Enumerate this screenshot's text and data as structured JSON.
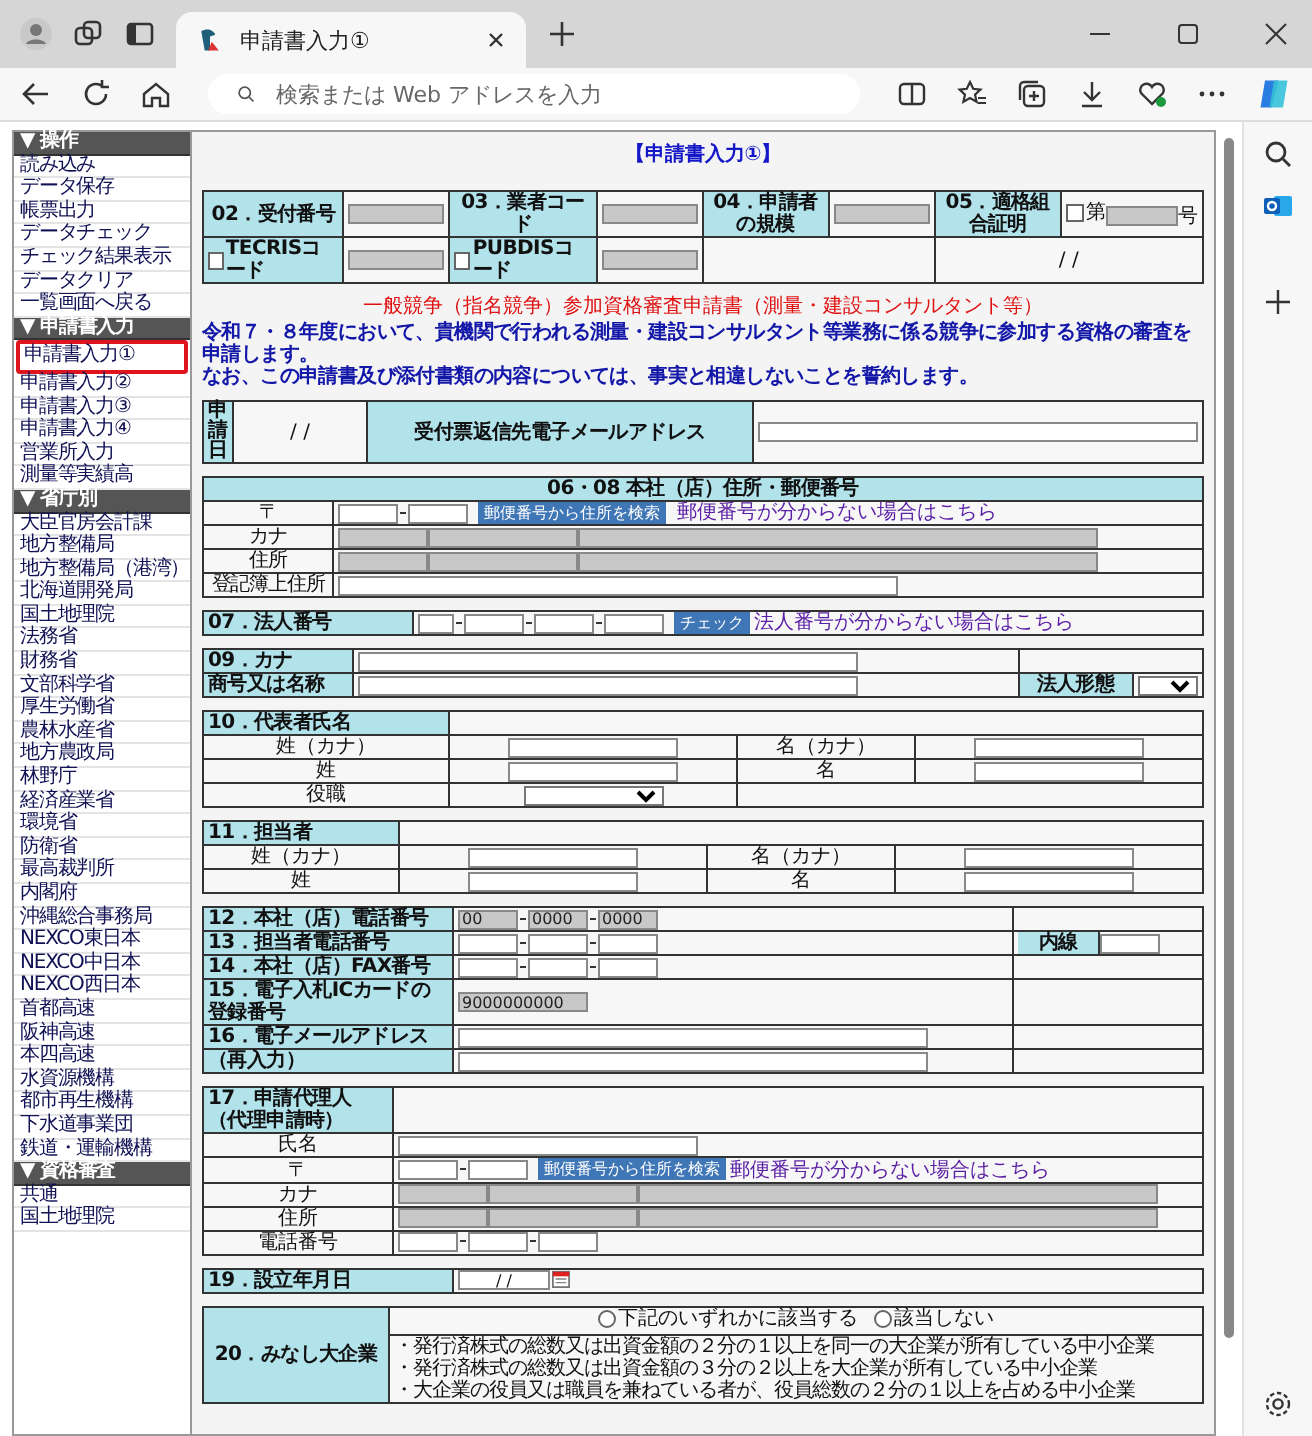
{
  "browser": {
    "tab_title": "申請書入力①",
    "address_placeholder": "検索または Web アドレスを入力"
  },
  "sidebar": [
    {
      "heading": "▼ 操作",
      "items": [
        {
          "label": "読み込み",
          "selected": false
        },
        {
          "label": "データ保存",
          "selected": false
        },
        {
          "label": "帳票出力",
          "selected": false
        },
        {
          "label": "データチェック",
          "selected": false
        },
        {
          "label": "チェック結果表示",
          "selected": false
        },
        {
          "label": "データクリア",
          "selected": false
        },
        {
          "label": "一覧画面へ戻る",
          "selected": false
        }
      ]
    },
    {
      "heading": "▼ 申請書入力",
      "items": [
        {
          "label": "申請書入力①",
          "selected": true
        },
        {
          "label": "申請書入力②",
          "selected": false
        },
        {
          "label": "申請書入力③",
          "selected": false
        },
        {
          "label": "申請書入力④",
          "selected": false
        },
        {
          "label": "営業所入力",
          "selected": false
        },
        {
          "label": "測量等実績高",
          "selected": false
        }
      ]
    },
    {
      "heading": "▼ 省庁別",
      "items": [
        {
          "label": "大臣官房会計課",
          "selected": false
        },
        {
          "label": "地方整備局",
          "selected": false
        },
        {
          "label": "地方整備局（港湾）",
          "selected": false
        },
        {
          "label": "北海道開発局",
          "selected": false
        },
        {
          "label": "国土地理院",
          "selected": false
        },
        {
          "label": "法務省",
          "selected": false
        },
        {
          "label": "財務省",
          "selected": false
        },
        {
          "label": "文部科学省",
          "selected": false
        },
        {
          "label": "厚生労働省",
          "selected": false
        },
        {
          "label": "農林水産省",
          "selected": false
        },
        {
          "label": "地方農政局",
          "selected": false
        },
        {
          "label": "林野庁",
          "selected": false
        },
        {
          "label": "経済産業省",
          "selected": false
        },
        {
          "label": "環境省",
          "selected": false
        },
        {
          "label": "防衛省",
          "selected": false
        },
        {
          "label": "最高裁判所",
          "selected": false
        },
        {
          "label": "内閣府",
          "selected": false
        },
        {
          "label": "沖縄総合事務局",
          "selected": false
        },
        {
          "label": "NEXCO東日本",
          "selected": false
        },
        {
          "label": "NEXCO中日本",
          "selected": false
        },
        {
          "label": "NEXCO西日本",
          "selected": false
        },
        {
          "label": "首都高速",
          "selected": false
        },
        {
          "label": "阪神高速",
          "selected": false
        },
        {
          "label": "本四高速",
          "selected": false
        },
        {
          "label": "水資源機構",
          "selected": false
        },
        {
          "label": "都市再生機構",
          "selected": false
        },
        {
          "label": "下水道事業団",
          "selected": false
        },
        {
          "label": "鉄道・運輸機構",
          "selected": false
        }
      ]
    },
    {
      "heading": "▼ 資格審査",
      "items": [
        {
          "label": "共通",
          "selected": false
        },
        {
          "label": "国土地理院",
          "selected": false
        }
      ]
    }
  ],
  "form": {
    "title": "【申請書入力①】",
    "header": {
      "items": [
        {
          "label": "02．受付番号",
          "field": {
            "disabled": true
          }
        },
        {
          "label": "03．業者コード",
          "field": {
            "disabled": true
          }
        },
        {
          "label": "04．申請者の規模",
          "field": {
            "disabled": true
          }
        }
      ],
      "certificate": {
        "label": "05．適格組合証明",
        "checked": false,
        "prefix": "第",
        "field": {
          "disabled": true
        },
        "suffix": "号",
        "date": "/ /"
      },
      "codes": [
        {
          "label": "TECRISコード",
          "checked": false,
          "field": {
            "disabled": true
          }
        },
        {
          "label": "PUBDISコード",
          "checked": false,
          "field": {
            "disabled": true
          }
        }
      ]
    },
    "notice": {
      "title": "一般競争（指名競争）参加資格審査申請書（測量・建設コンサルタント等）",
      "lines": [
        "令和７・８年度において、貴機関で行われる測量・建設コンサルタント等業務に係る競争に参加する資格の審査を申請します。",
        "なお、この申請書及び添付書類の内容については、事実と相違しないことを誓約します。"
      ]
    },
    "application": {
      "date_label": "申請日",
      "date": "/ /",
      "email_label": "受付票返信先電子メールアドレス",
      "email_field": {
        "disabled": false
      }
    },
    "head_office": {
      "title": "06・08 本社（店）住所・郵便番号",
      "postal_label": "〒",
      "postal_fields": [
        {
          "disabled": false
        },
        {
          "disabled": false
        }
      ],
      "search_button": "郵便番号から住所を検索",
      "help_link": "郵便番号が分からない場合はこちら",
      "rows": [
        {
          "label": "カナ",
          "fields": [
            {
              "disabled": true
            },
            {
              "disabled": true
            },
            {
              "disabled": true
            }
          ]
        },
        {
          "label": "住所",
          "fields": [
            {
              "disabled": true
            },
            {
              "disabled": true
            },
            {
              "disabled": true
            }
          ]
        }
      ],
      "registry_label": "登記簿上住所",
      "registry_field": {
        "disabled": false
      }
    },
    "corporate_number": {
      "label": "07．法人番号",
      "fields": [
        {
          "disabled": false
        },
        {
          "disabled": false
        },
        {
          "disabled": false
        },
        {
          "disabled": false
        }
      ],
      "check_button": "チェック",
      "help_link": "法人番号が分からない場合はこちら"
    },
    "company": {
      "kana_label": "09．カナ",
      "kana_field": {
        "disabled": false
      },
      "name_label": "商号又は名称",
      "name_field": {
        "disabled": false
      },
      "type_label": "法人形態"
    },
    "representative": {
      "title": "10．代表者氏名",
      "rows": [
        {
          "left": "姓（カナ）",
          "left_field": {
            "disabled": false
          },
          "right": "名（カナ）",
          "right_field": {
            "disabled": false
          }
        },
        {
          "left": "姓",
          "left_field": {
            "disabled": false
          },
          "right": "名",
          "right_field": {
            "disabled": false
          }
        }
      ],
      "position_label": "役職"
    },
    "contact": {
      "title": "11．担当者",
      "rows": [
        {
          "left": "姓（カナ）",
          "left_field": {
            "disabled": false
          },
          "right": "名（カナ）",
          "right_field": {
            "disabled": false
          }
        },
        {
          "left": "姓",
          "left_field": {
            "disabled": false
          },
          "right": "名",
          "right_field": {
            "disabled": false
          }
        }
      ]
    },
    "phones": [
      {
        "label": "12．本社（店）電話番号",
        "kind": "phone",
        "fields": [
          {
            "disabled": true,
            "value": "00"
          },
          {
            "disabled": true,
            "value": "0000"
          },
          {
            "disabled": true,
            "value": "0000"
          }
        ]
      },
      {
        "label": "13．担当者電話番号",
        "kind": "phone",
        "fields": [
          {
            "disabled": false
          },
          {
            "disabled": false
          },
          {
            "disabled": false
          }
        ],
        "extension_label": "内線",
        "extension_field": {
          "disabled": false
        }
      },
      {
        "label": "14．本社（店）FAX番号",
        "kind": "phone",
        "fields": [
          {
            "disabled": false
          },
          {
            "disabled": false
          },
          {
            "disabled": false
          }
        ]
      },
      {
        "label": "15．電子入札ICカードの登録番号",
        "kind": "short",
        "fields": [
          {
            "disabled": true,
            "value": "9000000000"
          }
        ]
      },
      {
        "label": "16．電子メールアドレス",
        "kind": "long",
        "fields": [
          {
            "disabled": false
          }
        ]
      },
      {
        "label": "（再入力）",
        "kind": "long",
        "fields": [
          {
            "disabled": false
          }
        ]
      }
    ],
    "agent": {
      "title": "17．申請代理人（代理申請時）",
      "name_label": "氏名",
      "name_field": {
        "disabled": false
      },
      "postal_label": "〒",
      "postal_fields": [
        {
          "disabled": false
        },
        {
          "disabled": false
        }
      ],
      "search_button": "郵便番号から住所を検索",
      "help_link": "郵便番号が分からない場合はこちら",
      "rows": [
        {
          "label": "カナ",
          "fields": [
            {
              "disabled": true
            },
            {
              "disabled": true
            },
            {
              "disabled": true
            }
          ]
        },
        {
          "label": "住所",
          "fields": [
            {
              "disabled": true
            },
            {
              "disabled": true
            },
            {
              "disabled": true
            }
          ]
        }
      ],
      "phone_label": "電話番号",
      "phone_fields": [
        {
          "disabled": false
        },
        {
          "disabled": false
        },
        {
          "disabled": false
        }
      ]
    },
    "founding": {
      "label": "19．設立年月日",
      "date": "/ /"
    },
    "deemed_large": {
      "label": "20．みなし大企業",
      "options": [
        {
          "label": "下記のいずれかに該当する",
          "selected": false
        },
        {
          "label": "該当しない",
          "selected": false
        }
      ],
      "conditions": [
        "・発行済株式の総数又は出資金額の２分の１以上を同一の大企業が所有している中小企業",
        "・発行済株式の総数又は出資金額の３分の２以上を大企業が所有している中小企業",
        "・大企業の役員又は職員を兼ねている者が、役員総数の２分の１以上を占める中小企業"
      ]
    }
  }
}
